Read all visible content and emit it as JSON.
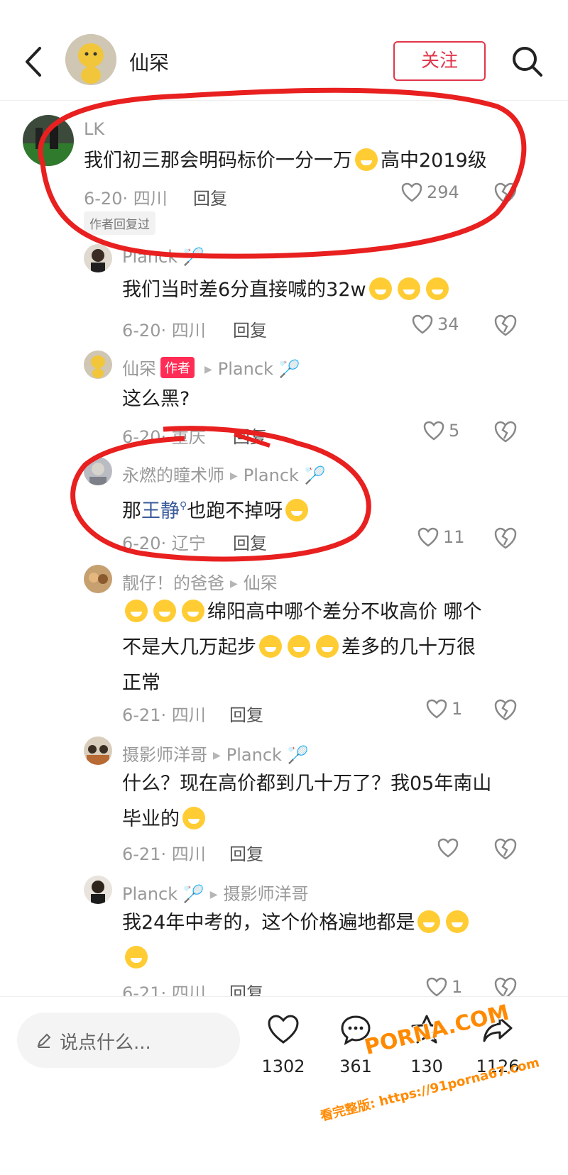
{
  "header": {
    "title": "仙罙",
    "follow_label": "关注"
  },
  "comments": [
    {
      "author": "LK",
      "text": "我们初三那会明码标价一分一万",
      "text_after": "高中2019级",
      "date": "6-20",
      "location": "四川",
      "reply_label": "回复",
      "likes": "294",
      "badge": "作者回复过"
    },
    {
      "author": "Planck",
      "text": "我们当时差6分直接喊的32w",
      "date": "6-20",
      "location": "四川",
      "reply_label": "回复",
      "likes": "34"
    },
    {
      "author": "仙罙",
      "author_tag": "作者",
      "reply_to": "Planck",
      "text": "这么黑?",
      "date": "6-20",
      "location": "重庆",
      "reply_label": "回复",
      "likes": "5"
    },
    {
      "author": "永燃的瞳术师",
      "reply_to": "Planck",
      "text_pre": "那",
      "text_link": "王静",
      "text_post": "也跑不掉呀",
      "date": "6-20",
      "location": "辽宁",
      "reply_label": "回复",
      "likes": "11"
    },
    {
      "author": "靓仔！的爸爸",
      "reply_to": "仙罙",
      "text_a": "绵阳高中哪个差分不收高价  哪个",
      "text_b": "不是大几万起步",
      "text_c": "差多的几十万很",
      "text_d": "正常",
      "date": "6-21",
      "location": "四川",
      "reply_label": "回复",
      "likes": "1"
    },
    {
      "author": "摄影师洋哥",
      "reply_to": "Planck",
      "text_a": "什么？现在高价都到几十万了？我05年南山",
      "text_b": "毕业的",
      "date": "6-21",
      "location": "四川",
      "reply_label": "回复",
      "likes": ""
    },
    {
      "author": "Planck",
      "reply_to": "摄影师洋哥",
      "text": "我24年中考的，这个价格遍地都是",
      "date": "6-21",
      "location": "四川",
      "reply_label": "回复",
      "likes": "1"
    }
  ],
  "bottom_bar": {
    "input_placeholder": "说点什么...",
    "like_count": "1302",
    "comment_count": "361",
    "star_count": "130",
    "share_count": "1126"
  },
  "watermark": {
    "line1": "PORNA.COM",
    "line2": "看完整版: https://91porna67.com"
  },
  "colors": {
    "accent": "#e0364a",
    "annotation": "#e8201f",
    "tag": "#ff2c55",
    "link": "#3a5b9a"
  }
}
